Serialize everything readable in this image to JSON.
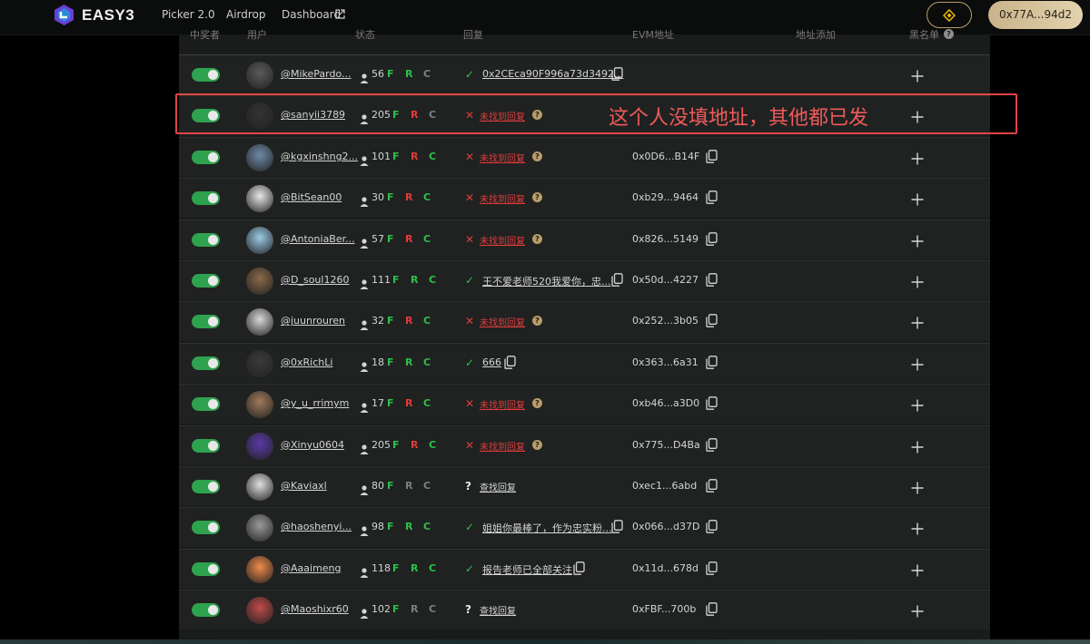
{
  "nav": {
    "brand": "EASY3",
    "links": [
      "Picker 2.0",
      "Airdrop",
      "Dashboard"
    ],
    "wallet": "0x77A...94d2"
  },
  "table": {
    "headers": [
      "中奖者",
      "用户",
      "状态",
      "回复",
      "EVM地址",
      "地址添加",
      "黑名单"
    ]
  },
  "annotation": "这个人没填地址，其他都已发",
  "colors": {
    "toggle_on": "#2fa24f",
    "green": "#2fbf4a",
    "red": "#e23b3b",
    "gray": "#7f7f7f",
    "gold": "#b89c6a"
  },
  "rows": [
    {
      "handle": "@MikePardo...",
      "followers": "56",
      "f": "green",
      "r": "green",
      "c": "gray",
      "status": "check",
      "reply": "0x2CEca90F996a73d3492...",
      "reply_kind": "text",
      "address": "",
      "avatar": "#5a5a5a"
    },
    {
      "handle": "@sanyii3789",
      "followers": "205",
      "f": "green",
      "r": "red",
      "c": "gray",
      "status": "x",
      "reply": "未找到回复",
      "reply_kind": "notfound",
      "address": "",
      "avatar": "#333"
    },
    {
      "handle": "@kgxinshng2...",
      "followers": "101",
      "f": "green",
      "r": "red",
      "c": "green",
      "status": "x",
      "reply": "未找到回复",
      "reply_kind": "notfound",
      "address": "0x0D6...B14F",
      "avatar": "#6f8aa8"
    },
    {
      "handle": "@BitSean00",
      "followers": "30",
      "f": "green",
      "r": "red",
      "c": "green",
      "status": "x",
      "reply": "未找到回复",
      "reply_kind": "notfound",
      "address": "0xb29...9464",
      "avatar": "#e8e8e8"
    },
    {
      "handle": "@AntoniaBer...",
      "followers": "57",
      "f": "green",
      "r": "red",
      "c": "green",
      "status": "x",
      "reply": "未找到回复",
      "reply_kind": "notfound",
      "address": "0x826...5149",
      "avatar": "#9ccbe8"
    },
    {
      "handle": "@D_soul1260",
      "followers": "111",
      "f": "green",
      "r": "green",
      "c": "green",
      "status": "check",
      "reply": "王不爱老师520我爱你，忠...",
      "reply_kind": "text",
      "address": "0x50d...4227",
      "avatar": "#8a6a4a"
    },
    {
      "handle": "@juunrouren",
      "followers": "32",
      "f": "green",
      "r": "red",
      "c": "green",
      "status": "x",
      "reply": "未找到回复",
      "reply_kind": "notfound",
      "address": "0x252...3b05",
      "avatar": "#d8d8d8"
    },
    {
      "handle": "@0xRichLi",
      "followers": "18",
      "f": "green",
      "r": "green",
      "c": "green",
      "status": "check",
      "reply": "666",
      "reply_kind": "text",
      "address": "0x363...6a31",
      "avatar": "#3a3a3a"
    },
    {
      "handle": "@y_u_rrimym",
      "followers": "17",
      "f": "green",
      "r": "red",
      "c": "green",
      "status": "x",
      "reply": "未找到回复",
      "reply_kind": "notfound",
      "address": "0xb46...a3D0",
      "avatar": "#a07a5a"
    },
    {
      "handle": "@Xinyu0604",
      "followers": "205",
      "f": "green",
      "r": "red",
      "c": "green",
      "status": "x",
      "reply": "未找到回复",
      "reply_kind": "notfound",
      "address": "0x775...D4Ba",
      "avatar": "#5a3aa8"
    },
    {
      "handle": "@Kaviaxl",
      "followers": "80",
      "f": "green",
      "r": "gray",
      "c": "gray",
      "status": "question",
      "reply": "查找回复",
      "reply_kind": "find",
      "address": "0xec1...6abd",
      "avatar": "#e0e0e0"
    },
    {
      "handle": "@haoshenyi...",
      "followers": "98",
      "f": "green",
      "r": "green",
      "c": "green",
      "status": "check",
      "reply": "姐姐你最棒了，作为忠实粉...",
      "reply_kind": "text",
      "address": "0x066...d37D",
      "avatar": "#9a9a9a"
    },
    {
      "handle": "@Aaaimeng",
      "followers": "118",
      "f": "green",
      "r": "green",
      "c": "green",
      "status": "check",
      "reply": "报告老师已全部关注",
      "reply_kind": "text",
      "address": "0x11d...678d",
      "avatar": "#f08a4a"
    },
    {
      "handle": "@Maoshixr60",
      "followers": "102",
      "f": "green",
      "r": "gray",
      "c": "gray",
      "status": "question",
      "reply": "查找回复",
      "reply_kind": "find",
      "address": "0xFBF...700b",
      "avatar": "#c04a4a"
    }
  ]
}
